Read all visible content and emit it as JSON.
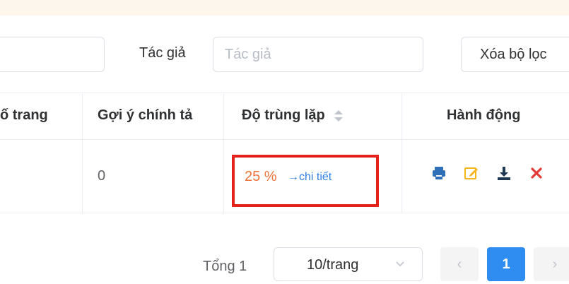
{
  "filters": {
    "author_label": "Tác giả",
    "author_placeholder": "Tác giả",
    "left_input_value": "",
    "clear_button": "Xóa bộ lọc"
  },
  "table": {
    "headers": [
      "ố trang",
      "Gợi ý chính tả",
      "Độ trùng lặp",
      "Hành động"
    ],
    "row": {
      "page_count": "",
      "spelling_suggestions": "0",
      "duplicate_percent": "25 %",
      "detail_link": "→chi tiết"
    }
  },
  "actions": [
    "print-icon",
    "edit-icon",
    "download-icon",
    "delete-icon"
  ],
  "pagination": {
    "total_label": "Tổng 1",
    "page_size": "10/trang",
    "current_page": "1",
    "prev": "‹",
    "next": "›"
  },
  "colors": {
    "accent_blue": "#2f8cf0",
    "percent_orange": "#f0743b",
    "highlight_red": "#e5211c",
    "edit_orange": "#f5b41e",
    "download_dark": "#1f3a52",
    "delete_red": "#e53935",
    "top_strip": "#fdf6ec"
  }
}
